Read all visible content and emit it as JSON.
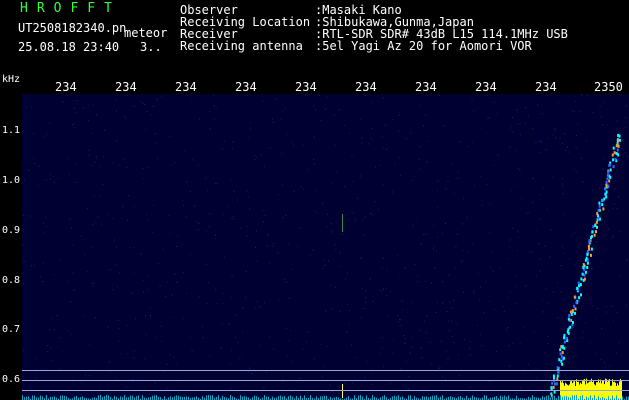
{
  "header": {
    "brand": "HROFFT",
    "file_name": "UT2508182340.pn",
    "mode_tag": "meteor",
    "date_time": "25.08.18 23:40",
    "segment": "3.."
  },
  "info": {
    "observer_label": "Observer",
    "observer_value": ":Masaki Kano",
    "location_label": "Receiving Location",
    "location_value": ":Shibukawa,Gunma,Japan",
    "receiver_label": "Receiver",
    "receiver_value": ":RTL-SDR SDR# 43dB L15 114.1MHz USB",
    "antenna_label": "Receiving antenna",
    "antenna_value": ":5el Yagi Az 20 for Aomori VOR"
  },
  "axes": {
    "y_unit": "kHz",
    "y_ticks": [
      "1.1",
      "1.0",
      "0.9",
      "0.8",
      "0.7",
      "0.6"
    ],
    "x_ticks": [
      "234",
      "234",
      "234",
      "234",
      "234",
      "234",
      "234",
      "234",
      "234",
      "2350"
    ]
  },
  "colors": {
    "background": "#000000",
    "plot_background": "#000033",
    "brand": "#33ff33",
    "signal_bright": "#00ffff",
    "signal_mid": "#ff9933",
    "noise_floor": "#ffff00"
  }
}
